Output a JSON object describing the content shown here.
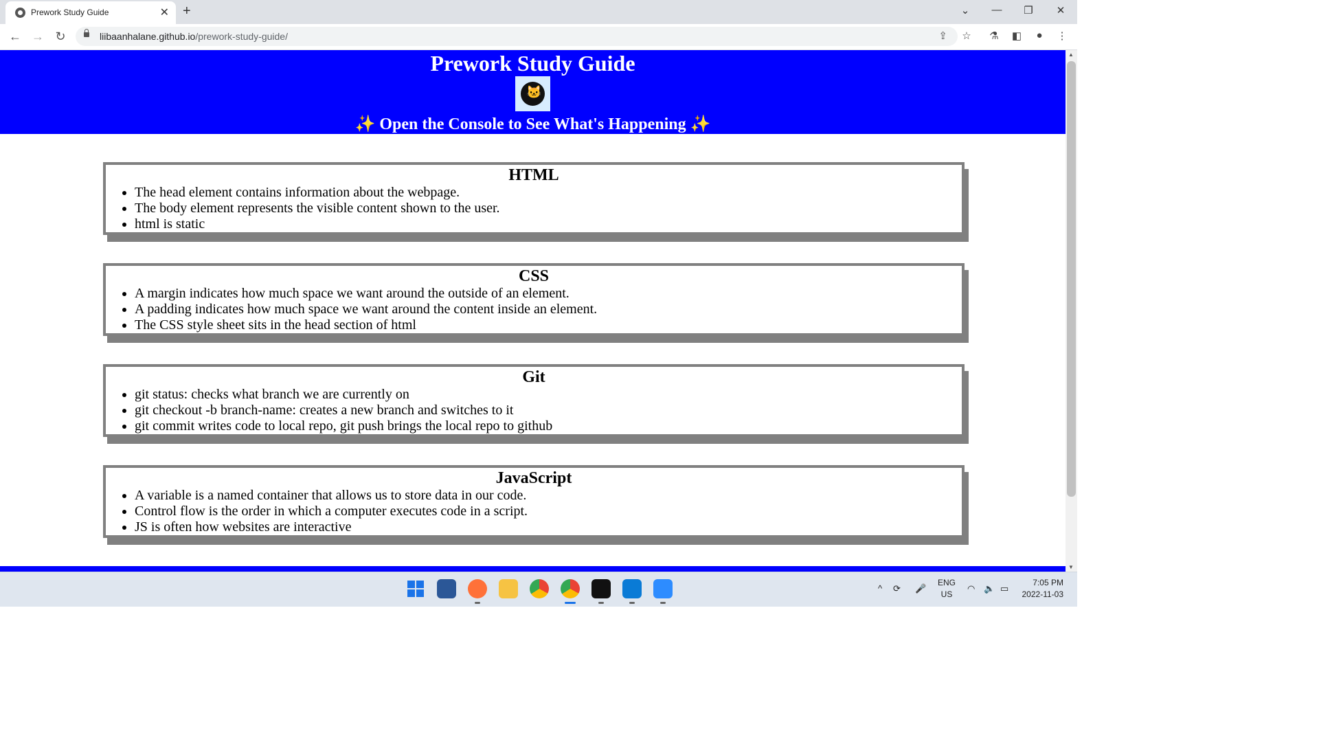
{
  "browser": {
    "tab_title": "Prework Study Guide",
    "tab_close": "✕",
    "new_tab": "+",
    "url_host": "liibaanhalane.github.io",
    "url_path": "/prework-study-guide/",
    "window_controls": [
      "⌄",
      "—",
      "❐",
      "✕"
    ]
  },
  "page": {
    "title": "Prework Study Guide",
    "subtitle": "Open the Console to See What's Happening",
    "sparkle": "✨",
    "sections": [
      {
        "heading": "HTML",
        "items": [
          "The head element contains information about the webpage.",
          "The body element represents the visible content shown to the user.",
          "html is static"
        ]
      },
      {
        "heading": "CSS",
        "items": [
          "A margin indicates how much space we want around the outside of an element.",
          "A padding indicates how much space we want around the content inside an element.",
          "The CSS style sheet sits in the head section of html"
        ]
      },
      {
        "heading": "Git",
        "items": [
          "git status: checks what branch we are currently on",
          "git checkout -b branch-name: creates a new branch and switches to it",
          "git commit writes code to local repo, git push brings the local repo to github"
        ]
      },
      {
        "heading": "JavaScript",
        "items": [
          "A variable is a named container that allows us to store data in our code.",
          "Control flow is the order in which a computer executes code in a script.",
          "JS is often how websites are interactive"
        ]
      }
    ]
  },
  "taskbar": {
    "lang": "ENG",
    "region": "US",
    "time": "7:05 PM",
    "date": "2022-11-03"
  },
  "colors": {
    "header_bg": "#0000ff",
    "card_border": "#808080"
  }
}
